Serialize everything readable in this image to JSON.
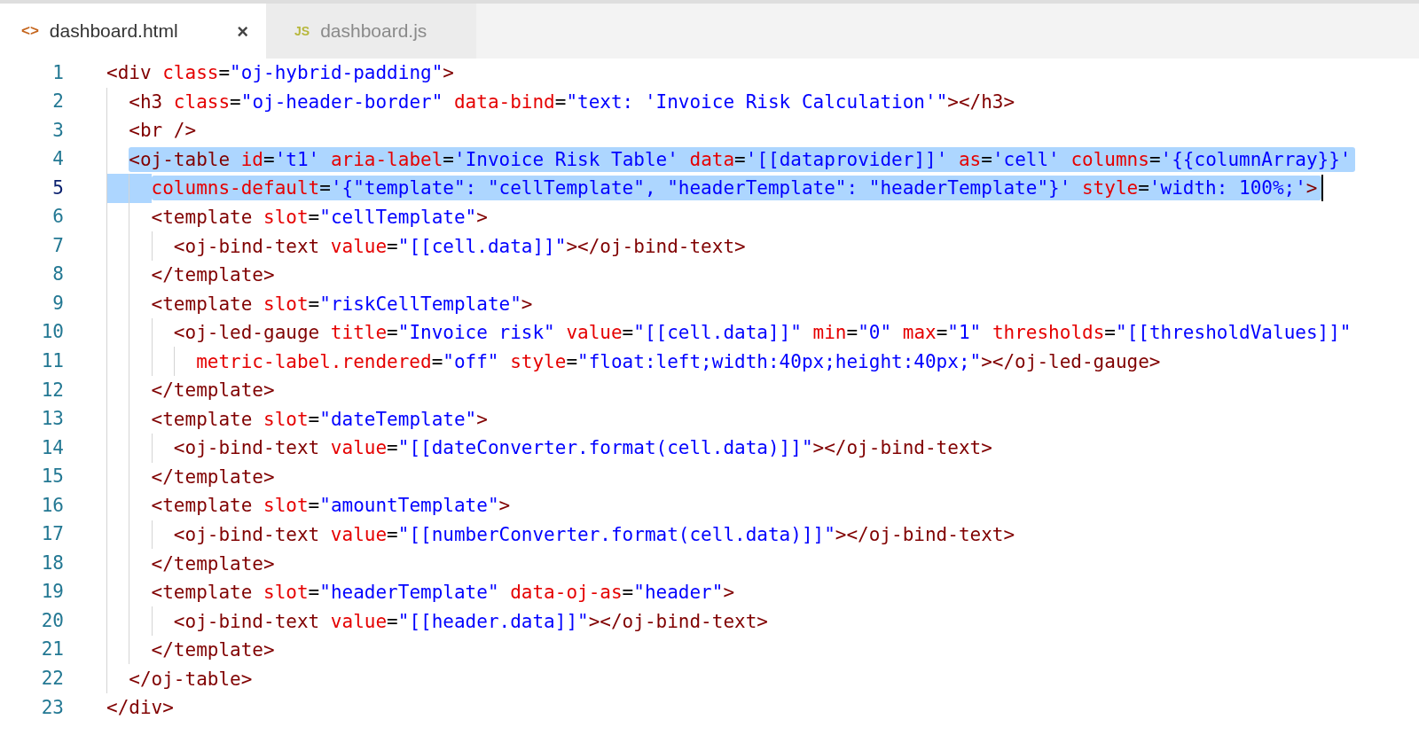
{
  "tabs": [
    {
      "label": "dashboard.html",
      "kind": "html",
      "selected": true,
      "icon": "<>",
      "close": "×"
    },
    {
      "label": "dashboard.js",
      "kind": "js",
      "selected": false,
      "icon": "JS"
    }
  ],
  "lines": [
    {
      "number": "1",
      "selected": false,
      "cursor": false,
      "tokens": [
        {
          "kind": "tag",
          "text": "<div"
        },
        {
          "kind": "attr",
          "text": " class"
        },
        {
          "kind": "plain",
          "text": "="
        },
        {
          "kind": "str",
          "text": "\"oj-hybrid-padding\""
        },
        {
          "kind": "tag",
          "text": ">"
        }
      ]
    },
    {
      "number": "2",
      "selected": false,
      "cursor": false,
      "tokens": [
        {
          "kind": "tag",
          "text": "  <h3"
        },
        {
          "kind": "attr",
          "text": " class"
        },
        {
          "kind": "plain",
          "text": "="
        },
        {
          "kind": "str",
          "text": "\"oj-header-border\""
        },
        {
          "kind": "attr",
          "text": " data-bind"
        },
        {
          "kind": "plain",
          "text": "="
        },
        {
          "kind": "str",
          "text": "\"text: 'Invoice Risk Calculation'\""
        },
        {
          "kind": "tag",
          "text": "></h3>"
        }
      ]
    },
    {
      "number": "3",
      "selected": false,
      "cursor": false,
      "tokens": [
        {
          "kind": "tag",
          "text": "  <br />"
        }
      ]
    },
    {
      "number": "4",
      "selected": true,
      "cursor": false,
      "tokens": [
        {
          "kind": "tag",
          "text": "  <oj-table"
        },
        {
          "kind": "attr",
          "text": " id"
        },
        {
          "kind": "plain",
          "text": "="
        },
        {
          "kind": "str",
          "text": "'t1'"
        },
        {
          "kind": "attr",
          "text": " aria-label"
        },
        {
          "kind": "plain",
          "text": "="
        },
        {
          "kind": "str",
          "text": "'Invoice Risk Table'"
        },
        {
          "kind": "attr",
          "text": " data"
        },
        {
          "kind": "plain",
          "text": "="
        },
        {
          "kind": "str",
          "text": "'[[dataprovider]]'"
        },
        {
          "kind": "attr",
          "text": " as"
        },
        {
          "kind": "plain",
          "text": "="
        },
        {
          "kind": "str",
          "text": "'cell'"
        },
        {
          "kind": "attr",
          "text": " columns"
        },
        {
          "kind": "plain",
          "text": "="
        },
        {
          "kind": "str",
          "text": "'{{columnArray}}'"
        }
      ]
    },
    {
      "number": "5",
      "selected": true,
      "cursor": true,
      "tokens": [
        {
          "kind": "attr",
          "text": "    columns-default"
        },
        {
          "kind": "plain",
          "text": "="
        },
        {
          "kind": "str",
          "text": "'{\"template\": \"cellTemplate\", \"headerTemplate\": \"headerTemplate\"}'"
        },
        {
          "kind": "attr",
          "text": " style"
        },
        {
          "kind": "plain",
          "text": "="
        },
        {
          "kind": "str",
          "text": "'width: 100%;'"
        },
        {
          "kind": "tag",
          "text": ">"
        }
      ]
    },
    {
      "number": "6",
      "selected": false,
      "cursor": false,
      "tokens": [
        {
          "kind": "tag",
          "text": "    <template"
        },
        {
          "kind": "attr",
          "text": " slot"
        },
        {
          "kind": "plain",
          "text": "="
        },
        {
          "kind": "str",
          "text": "\"cellTemplate\""
        },
        {
          "kind": "tag",
          "text": ">"
        }
      ]
    },
    {
      "number": "7",
      "selected": false,
      "cursor": false,
      "tokens": [
        {
          "kind": "tag",
          "text": "      <oj-bind-text"
        },
        {
          "kind": "attr",
          "text": " value"
        },
        {
          "kind": "plain",
          "text": "="
        },
        {
          "kind": "str",
          "text": "\"[[cell.data]]\""
        },
        {
          "kind": "tag",
          "text": "></oj-bind-text>"
        }
      ]
    },
    {
      "number": "8",
      "selected": false,
      "cursor": false,
      "tokens": [
        {
          "kind": "tag",
          "text": "    </template>"
        }
      ]
    },
    {
      "number": "9",
      "selected": false,
      "cursor": false,
      "tokens": [
        {
          "kind": "tag",
          "text": "    <template"
        },
        {
          "kind": "attr",
          "text": " slot"
        },
        {
          "kind": "plain",
          "text": "="
        },
        {
          "kind": "str",
          "text": "\"riskCellTemplate\""
        },
        {
          "kind": "tag",
          "text": ">"
        }
      ]
    },
    {
      "number": "10",
      "selected": false,
      "cursor": false,
      "tokens": [
        {
          "kind": "tag",
          "text": "      <oj-led-gauge"
        },
        {
          "kind": "attr",
          "text": " title"
        },
        {
          "kind": "plain",
          "text": "="
        },
        {
          "kind": "str",
          "text": "\"Invoice risk\""
        },
        {
          "kind": "attr",
          "text": " value"
        },
        {
          "kind": "plain",
          "text": "="
        },
        {
          "kind": "str",
          "text": "\"[[cell.data]]\""
        },
        {
          "kind": "attr",
          "text": " min"
        },
        {
          "kind": "plain",
          "text": "="
        },
        {
          "kind": "str",
          "text": "\"0\""
        },
        {
          "kind": "attr",
          "text": " max"
        },
        {
          "kind": "plain",
          "text": "="
        },
        {
          "kind": "str",
          "text": "\"1\""
        },
        {
          "kind": "attr",
          "text": " thresholds"
        },
        {
          "kind": "plain",
          "text": "="
        },
        {
          "kind": "str",
          "text": "\"[[thresholdValues]]\""
        }
      ]
    },
    {
      "number": "11",
      "selected": false,
      "cursor": false,
      "tokens": [
        {
          "kind": "attr",
          "text": "        metric-label.rendered"
        },
        {
          "kind": "plain",
          "text": "="
        },
        {
          "kind": "str",
          "text": "\"off\""
        },
        {
          "kind": "attr",
          "text": " style"
        },
        {
          "kind": "plain",
          "text": "="
        },
        {
          "kind": "str",
          "text": "\"float:left;width:40px;height:40px;\""
        },
        {
          "kind": "tag",
          "text": "></oj-led-gauge>"
        }
      ]
    },
    {
      "number": "12",
      "selected": false,
      "cursor": false,
      "tokens": [
        {
          "kind": "tag",
          "text": "    </template>"
        }
      ]
    },
    {
      "number": "13",
      "selected": false,
      "cursor": false,
      "tokens": [
        {
          "kind": "tag",
          "text": "    <template"
        },
        {
          "kind": "attr",
          "text": " slot"
        },
        {
          "kind": "plain",
          "text": "="
        },
        {
          "kind": "str",
          "text": "\"dateTemplate\""
        },
        {
          "kind": "tag",
          "text": ">"
        }
      ]
    },
    {
      "number": "14",
      "selected": false,
      "cursor": false,
      "tokens": [
        {
          "kind": "tag",
          "text": "      <oj-bind-text"
        },
        {
          "kind": "attr",
          "text": " value"
        },
        {
          "kind": "plain",
          "text": "="
        },
        {
          "kind": "str",
          "text": "\"[[dateConverter.format(cell.data)]]\""
        },
        {
          "kind": "tag",
          "text": "></oj-bind-text>"
        }
      ]
    },
    {
      "number": "15",
      "selected": false,
      "cursor": false,
      "tokens": [
        {
          "kind": "tag",
          "text": "    </template>"
        }
      ]
    },
    {
      "number": "16",
      "selected": false,
      "cursor": false,
      "tokens": [
        {
          "kind": "tag",
          "text": "    <template"
        },
        {
          "kind": "attr",
          "text": " slot"
        },
        {
          "kind": "plain",
          "text": "="
        },
        {
          "kind": "str",
          "text": "\"amountTemplate\""
        },
        {
          "kind": "tag",
          "text": ">"
        }
      ]
    },
    {
      "number": "17",
      "selected": false,
      "cursor": false,
      "tokens": [
        {
          "kind": "tag",
          "text": "      <oj-bind-text"
        },
        {
          "kind": "attr",
          "text": " value"
        },
        {
          "kind": "plain",
          "text": "="
        },
        {
          "kind": "str",
          "text": "\"[[numberConverter.format(cell.data)]]\""
        },
        {
          "kind": "tag",
          "text": "></oj-bind-text>"
        }
      ]
    },
    {
      "number": "18",
      "selected": false,
      "cursor": false,
      "tokens": [
        {
          "kind": "tag",
          "text": "    </template>"
        }
      ]
    },
    {
      "number": "19",
      "selected": false,
      "cursor": false,
      "tokens": [
        {
          "kind": "tag",
          "text": "    <template"
        },
        {
          "kind": "attr",
          "text": " slot"
        },
        {
          "kind": "plain",
          "text": "="
        },
        {
          "kind": "str",
          "text": "\"headerTemplate\""
        },
        {
          "kind": "attr",
          "text": " data-oj-as"
        },
        {
          "kind": "plain",
          "text": "="
        },
        {
          "kind": "str",
          "text": "\"header\""
        },
        {
          "kind": "tag",
          "text": ">"
        }
      ]
    },
    {
      "number": "20",
      "selected": false,
      "cursor": false,
      "tokens": [
        {
          "kind": "tag",
          "text": "      <oj-bind-text"
        },
        {
          "kind": "attr",
          "text": " value"
        },
        {
          "kind": "plain",
          "text": "="
        },
        {
          "kind": "str",
          "text": "\"[[header.data]]\""
        },
        {
          "kind": "tag",
          "text": "></oj-bind-text>"
        }
      ]
    },
    {
      "number": "21",
      "selected": false,
      "cursor": false,
      "tokens": [
        {
          "kind": "tag",
          "text": "    </template>"
        }
      ]
    },
    {
      "number": "22",
      "selected": false,
      "cursor": false,
      "tokens": [
        {
          "kind": "tag",
          "text": "  </oj-table>"
        }
      ]
    },
    {
      "number": "23",
      "selected": false,
      "cursor": false,
      "tokens": [
        {
          "kind": "tag",
          "text": "</div>"
        }
      ]
    }
  ]
}
